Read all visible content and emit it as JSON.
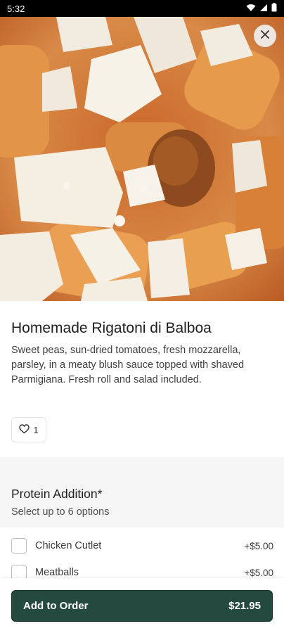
{
  "status_bar": {
    "time": "5:32"
  },
  "item": {
    "title": "Homemade Rigatoni di Balboa",
    "description": "Sweet peas, sun-dried tomatoes, fresh mozzarella, parsley, in a meaty blush sauce topped with shaved Parmigiana. Fresh roll and salad included.",
    "like_count": "1"
  },
  "section": {
    "title": "Protein Addition*",
    "subtitle": "Select up to 6 options"
  },
  "options": [
    {
      "label": "Chicken Cutlet",
      "price": "+$5.00"
    },
    {
      "label": "Meatballs",
      "price": "+$5.00"
    }
  ],
  "footer": {
    "button_label": "Add to Order",
    "total": "$21.95"
  },
  "colors": {
    "primary_button": "#244a3f",
    "section_background": "#f5f5f5"
  },
  "icons": [
    "wifi-icon",
    "signal-icon",
    "battery-icon",
    "close-icon",
    "heart-icon"
  ]
}
